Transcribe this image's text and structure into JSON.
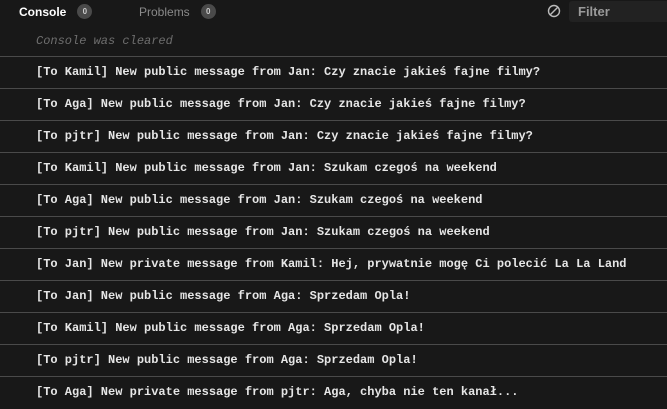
{
  "tabs": [
    {
      "label": "Console",
      "count": "0"
    },
    {
      "label": "Problems",
      "count": "0"
    }
  ],
  "filter": {
    "placeholder": "Filter"
  },
  "cleared_text": "Console was cleared",
  "messages": [
    "[To Kamil] New public message from Jan: Czy znacie jakieś fajne filmy?",
    "[To Aga] New public message from Jan: Czy znacie jakieś fajne filmy?",
    "[To pjtr] New public message from Jan: Czy znacie jakieś fajne filmy?",
    "[To Kamil] New public message from Jan: Szukam czegoś na weekend",
    "[To Aga] New public message from Jan: Szukam czegoś na weekend",
    "[To pjtr] New public message from Jan: Szukam czegoś na weekend",
    "[To Jan] New private message from Kamil: Hej, prywatnie mogę Ci polecić La La Land",
    "[To Jan] New public message from Aga: Sprzedam Opla!",
    "[To Kamil] New public message from Aga: Sprzedam Opla!",
    "[To pjtr] New public message from Aga: Sprzedam Opla!",
    "[To Aga] New private message from pjtr: Aga, chyba nie ten kanał..."
  ]
}
